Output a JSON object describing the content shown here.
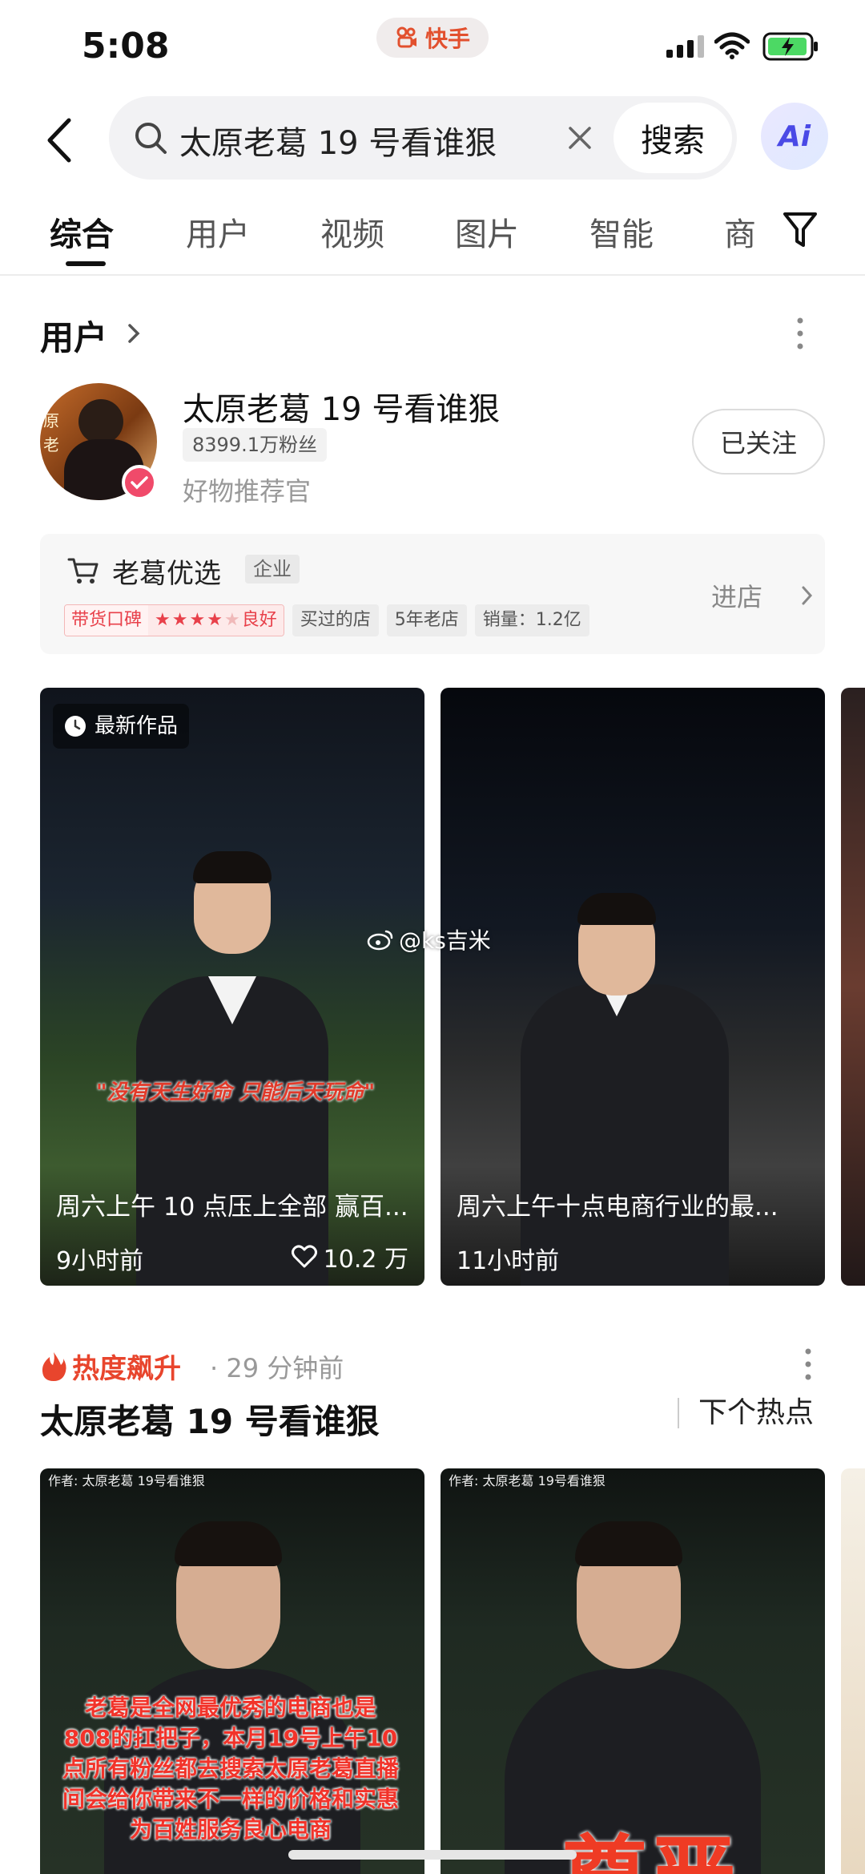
{
  "status_bar": {
    "time": "5:08",
    "app_name": "快手"
  },
  "search": {
    "query": "太原老葛 19 号看谁狠",
    "submit_label": "搜索",
    "ai_label": "Ai"
  },
  "tabs": [
    {
      "label": "综合",
      "active": true
    },
    {
      "label": "用户"
    },
    {
      "label": "视频"
    },
    {
      "label": "图片"
    },
    {
      "label": "智能"
    },
    {
      "label": "商"
    }
  ],
  "user_section": {
    "header": "用户",
    "user": {
      "name": "太原老葛 19 号看谁狠",
      "fans": "8399.1万粉丝",
      "description": "好物推荐官",
      "follow_label": "已关注",
      "avatar_text": "原老"
    },
    "shop": {
      "name": "老葛优选",
      "type_badge": "企业",
      "reputation_label": "带货口碑",
      "reputation_rating": 4,
      "reputation_value": "良好",
      "tags": [
        "买过的店",
        "5年老店",
        "销量：1.2亿"
      ],
      "enter_label": "进店"
    }
  },
  "videos": [
    {
      "badge": "最新作品",
      "caption_overlay": "\"没有天生好命 只能后天玩命\"",
      "title": "周六上午 10 点压上全部 赢百...",
      "time": "9小时前",
      "likes": "10.2 万"
    },
    {
      "title": "周六上午十点电商行业的最...",
      "time": "11小时前"
    }
  ],
  "watermark": "@ks吉米",
  "trending": {
    "label": "热度飙升",
    "time": "· 29 分钟前",
    "title": "太原老葛 19 号看谁狠",
    "next_label": "下个热点",
    "cards": [
      {
        "author": "作者: 太原老葛 19号看谁狠",
        "overlay": "老葛是全网最优秀的电商也是808的扛把子，本月19号上午10点所有粉丝都去搜索太原老葛直播间会给你带来不一样的价格和实惠为百姓服务良心电商"
      },
      {
        "author": "作者: 太原老葛 19号看谁狠",
        "big_word": "尊严"
      }
    ]
  },
  "colors": {
    "accent_red": "#e8404a",
    "hot_orange": "#e8452d",
    "ai_blue": "#4a49e6"
  }
}
